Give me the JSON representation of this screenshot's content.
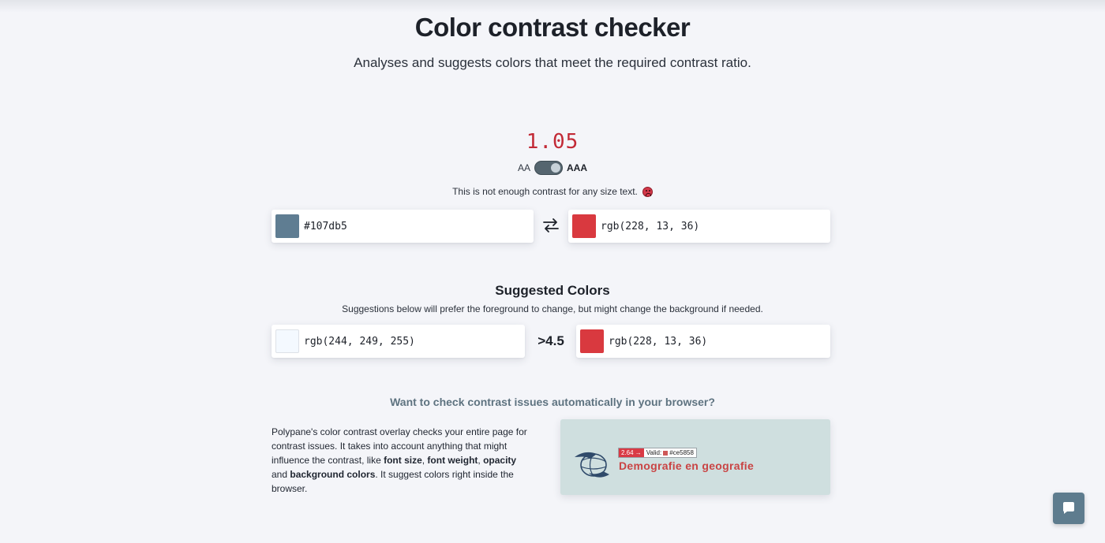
{
  "page": {
    "title": "Color contrast checker",
    "subtitle": "Analyses and suggests colors that meet the required contrast ratio."
  },
  "result": {
    "ratio": "1.05",
    "level_left": "AA",
    "level_right": "AAA",
    "level_selected": "AAA",
    "status": "This is not enough contrast for any size text.",
    "status_icon": "sad-face-icon",
    "ratio_color": "#c22a36"
  },
  "inputs": {
    "foreground": {
      "value": "#107db5",
      "swatch": "#5f7d92"
    },
    "background": {
      "value": "rgb(228, 13, 36)",
      "swatch": "#d9393f"
    },
    "swap_icon": "swap-arrows-icon"
  },
  "suggestions": {
    "title": "Suggested Colors",
    "description": "Suggestions below will prefer the foreground to change, but might change the background if needed.",
    "threshold": ">4.5",
    "foreground": {
      "value": "rgb(244, 249, 255)",
      "swatch": "#f4f9ff"
    },
    "background": {
      "value": "rgb(228, 13, 36)",
      "swatch": "#d9393f"
    }
  },
  "promo": {
    "title": "Want to check contrast issues automatically in your browser?",
    "text_1": "Polypane's color contrast overlay checks your entire page for contrast issues. It takes into account anything that might influence the contrast, like ",
    "bold_1": "font size",
    "text_2": ", ",
    "bold_2": "font weight",
    "text_3": ", ",
    "bold_3": "opacity",
    "text_4": " and ",
    "bold_4": "background colors",
    "text_5": ". It suggest colors right inside the browser.",
    "image": {
      "badge_ratio": "2.64 →",
      "badge_label": "Valid:",
      "badge_color": "#ce5858",
      "heading": "Demografie en geografie",
      "logo_icon": "globe-logo-icon"
    }
  },
  "chat": {
    "icon": "chat-bubble-icon"
  }
}
